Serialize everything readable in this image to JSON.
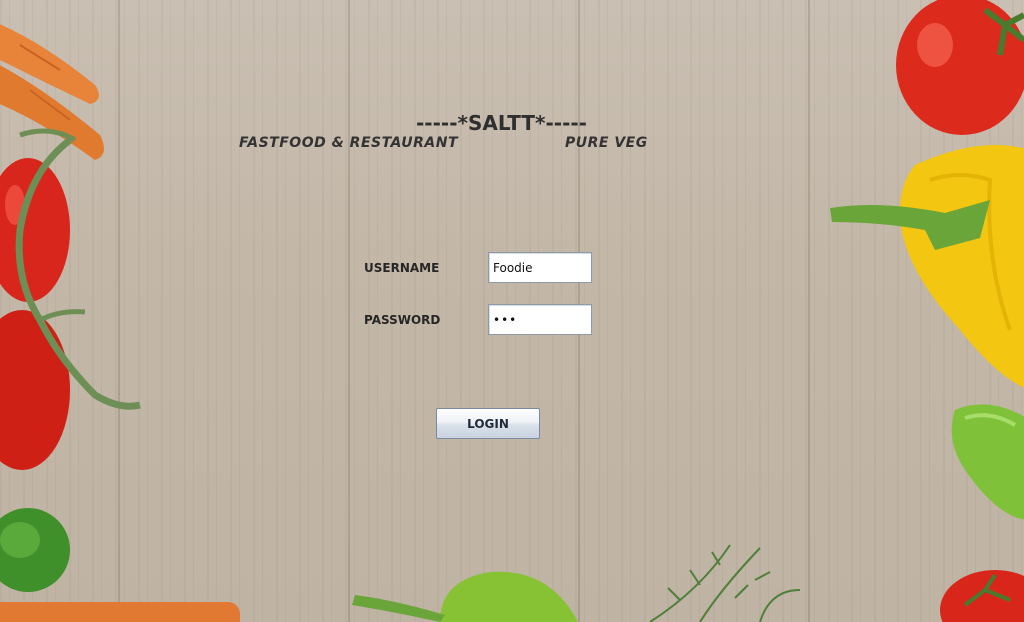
{
  "header": {
    "title": "-----*SALTT*-----",
    "subtitle_left": "FASTFOOD & RESTAURANT",
    "subtitle_right": "PURE VEG"
  },
  "form": {
    "username_label": "USERNAME",
    "username_value": "Foodie",
    "password_label": "PASSWORD",
    "password_value": "•••",
    "login_label": "LOGIN"
  },
  "colors": {
    "text": "#2f2f2f",
    "button_border": "#7a8aa0",
    "field_border": "#8e9aa8"
  },
  "decorations": [
    "wood-background",
    "carrot-image",
    "tomato-image",
    "yellow-pepper-image",
    "cucumber-image",
    "green-pepper-image",
    "herb-image"
  ]
}
